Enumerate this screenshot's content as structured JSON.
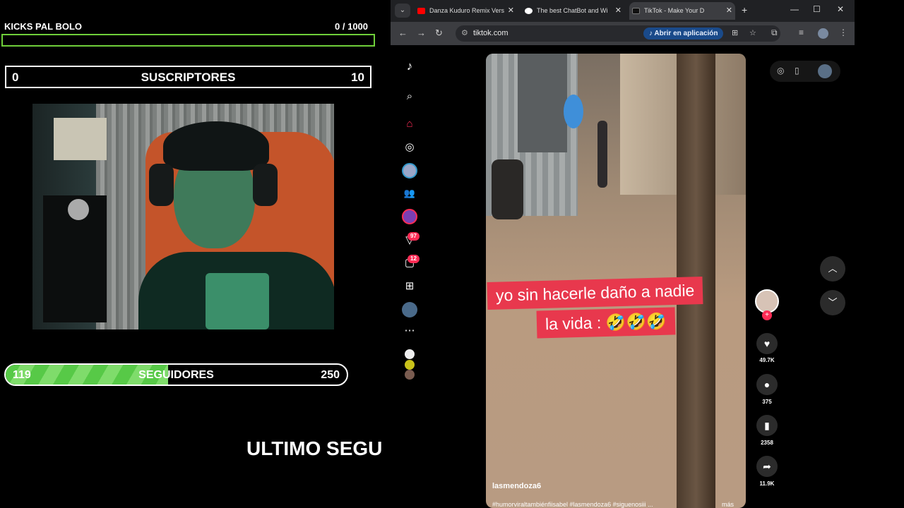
{
  "overlay": {
    "goal_title": "KICKS PAL BOLO",
    "goal_current": "0",
    "goal_total": "/ 1000",
    "goal_progress": 0,
    "subs_left": "0",
    "subs_label": "SUSCRIPTORES",
    "subs_right": "10",
    "followers_left": "119",
    "followers_label": "SEGUIDORES",
    "followers_right": "250",
    "followers_progress": 0.476,
    "ultimo": "ULTIMO SEGU"
  },
  "browser": {
    "tabs": [
      {
        "title": "Danza Kuduro Remix Vers",
        "favicon_color": "#ff0000",
        "active": false
      },
      {
        "title": "The best ChatBot and Wi",
        "favicon_color": "#ffffff",
        "active": false
      },
      {
        "title": "TikTok - Make Your D",
        "favicon_color": "#000000",
        "active": true
      }
    ],
    "url": "tiktok.com",
    "open_app_label": "Abrir en aplicación",
    "colors": {
      "tiktok_red": "#fe2c55",
      "caption_red": "#e8384d",
      "goal_green": "#6fcf3a"
    }
  },
  "tiktok": {
    "badges": {
      "inbox": "97",
      "messages": "12"
    },
    "caption_line1": "yo sin hacerle daño a nadie",
    "caption_line2": "la vida : 🤣🤣🤣",
    "author": "lasmendoza6",
    "tags": "#humorviraltambiénfiisabel #lasmendoza6 #siguenosiii ...",
    "more": "más",
    "likes": "49.7K",
    "comments": "375",
    "saves": "2358",
    "shares": "11.9K"
  }
}
